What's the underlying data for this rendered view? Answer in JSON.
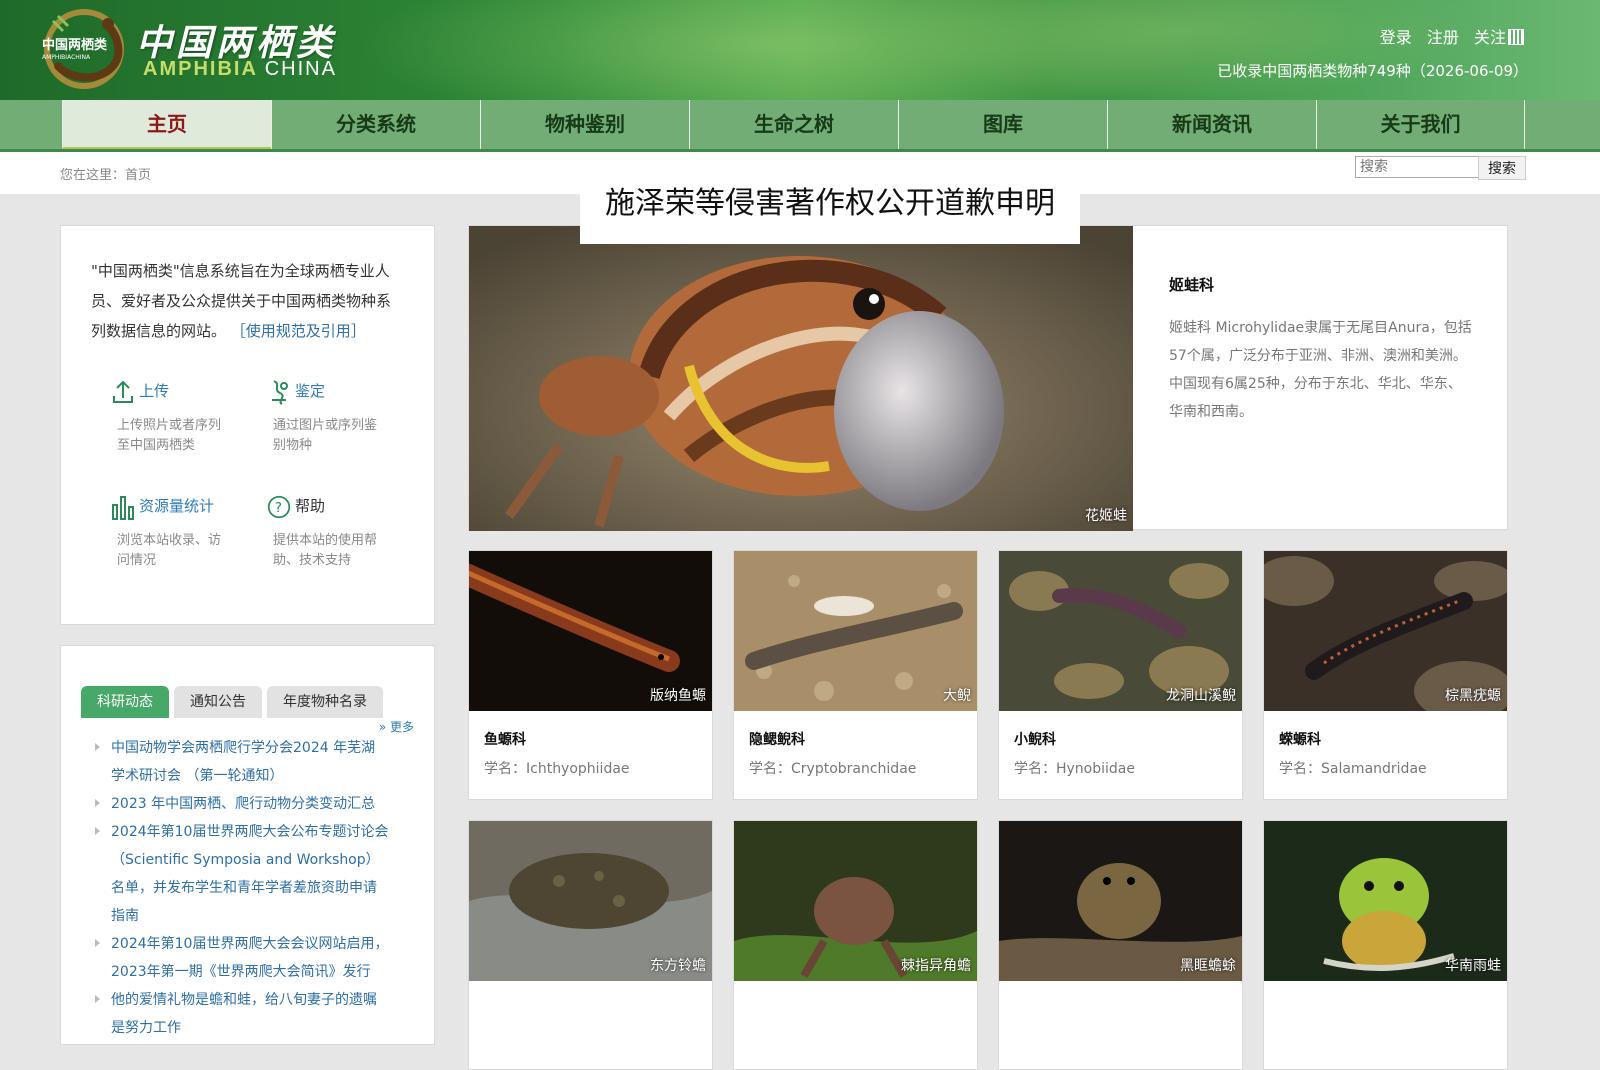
{
  "header": {
    "logo_badge_text": "中国两栖类",
    "logo_badge_sub": "AMPHIBIACHINA",
    "logo_cn": "中国两栖类",
    "logo_en_a": "AMPHIBIA",
    "logo_en_b": "CHINA",
    "login": "登录",
    "register": "注册",
    "follow": "关注",
    "species_count": "已收录中国两栖类物种749种（2026-06-09）"
  },
  "nav": {
    "items": [
      "主页",
      "分类系统",
      "物种鉴别",
      "生命之树",
      "图库",
      "新闻资讯",
      "关于我们"
    ],
    "active_index": 0
  },
  "breadcrumb": {
    "text": "您在这里：首页"
  },
  "search": {
    "placeholder": "搜索",
    "button": "搜索"
  },
  "intro": {
    "text": "\"中国两栖类\"信息系统旨在为全球两栖专业人员、爱好者及公众提供关于中国两栖类物种系列数据信息的网站。",
    "link": "［使用规范及引用］",
    "tools": [
      {
        "icon": "upload-icon",
        "title": "上传",
        "desc": "上传照片或者序列至中国两栖类"
      },
      {
        "icon": "identify-icon",
        "title": "鉴定",
        "desc": "通过图片或序列鉴别物种"
      },
      {
        "icon": "stats-icon",
        "title": "资源量统计",
        "desc": "浏览本站收录、访问情况"
      },
      {
        "icon": "help-icon",
        "title": "帮助",
        "desc": "提供本站的使用帮助、技术支持"
      }
    ]
  },
  "news": {
    "tabs": [
      "科研动态",
      "通知公告",
      "年度物种名录"
    ],
    "active_tab": 0,
    "more": "» 更多",
    "items": [
      "中国动物学会两栖爬行学分会2024 年芜湖学术研讨会 （第一轮通知）",
      "2023 年中国两栖、爬行动物分类变动汇总",
      "2024年第10届世界两爬大会公布专题讨论会（Scientific Symposia and Workshop）名单，并发布学生和青年学者差旅资助申请指南",
      "2024年第10届世界两爬大会会议网站启用，2023年第一期《世界两爬大会简讯》发行",
      "他的爱情礼物是蟾和蛙，给八旬妻子的遗嘱是努力工作"
    ]
  },
  "feature": {
    "title": "施泽荣等侵害著作权公开道歉申明",
    "photo_label": "花姬蛙",
    "family": "姬蛙科",
    "desc": "姬蛙科 Microhylidae隶属于无尾目Anura，包括57个属，广泛分布于亚洲、非洲、澳洲和美洲。中国现有6属25种，分布于东北、华北、华东、华南和西南。"
  },
  "cards": [
    {
      "photo_label": "版纳鱼螈",
      "family": "鱼螈科",
      "sci": "学名：Ichthyophiidae"
    },
    {
      "photo_label": "大鲵",
      "family": "隐鳃鲵科",
      "sci": "学名：Cryptobranchidae"
    },
    {
      "photo_label": "龙洞山溪鲵",
      "family": "小鲵科",
      "sci": "学名：Hynobiidae"
    },
    {
      "photo_label": "棕黑疣螈",
      "family": "蝾螈科",
      "sci": "学名：Salamandridae"
    },
    {
      "photo_label": "东方铃蟾"
    },
    {
      "photo_label": "棘指异角蟾"
    },
    {
      "photo_label": "黑眶蟾蜍"
    },
    {
      "photo_label": "华南雨蛙"
    }
  ],
  "colors": {
    "nav_bg": "#73ad76",
    "nav_active_text": "#8b1919",
    "link": "#2d7bb8",
    "tab_active": "#48a868"
  }
}
